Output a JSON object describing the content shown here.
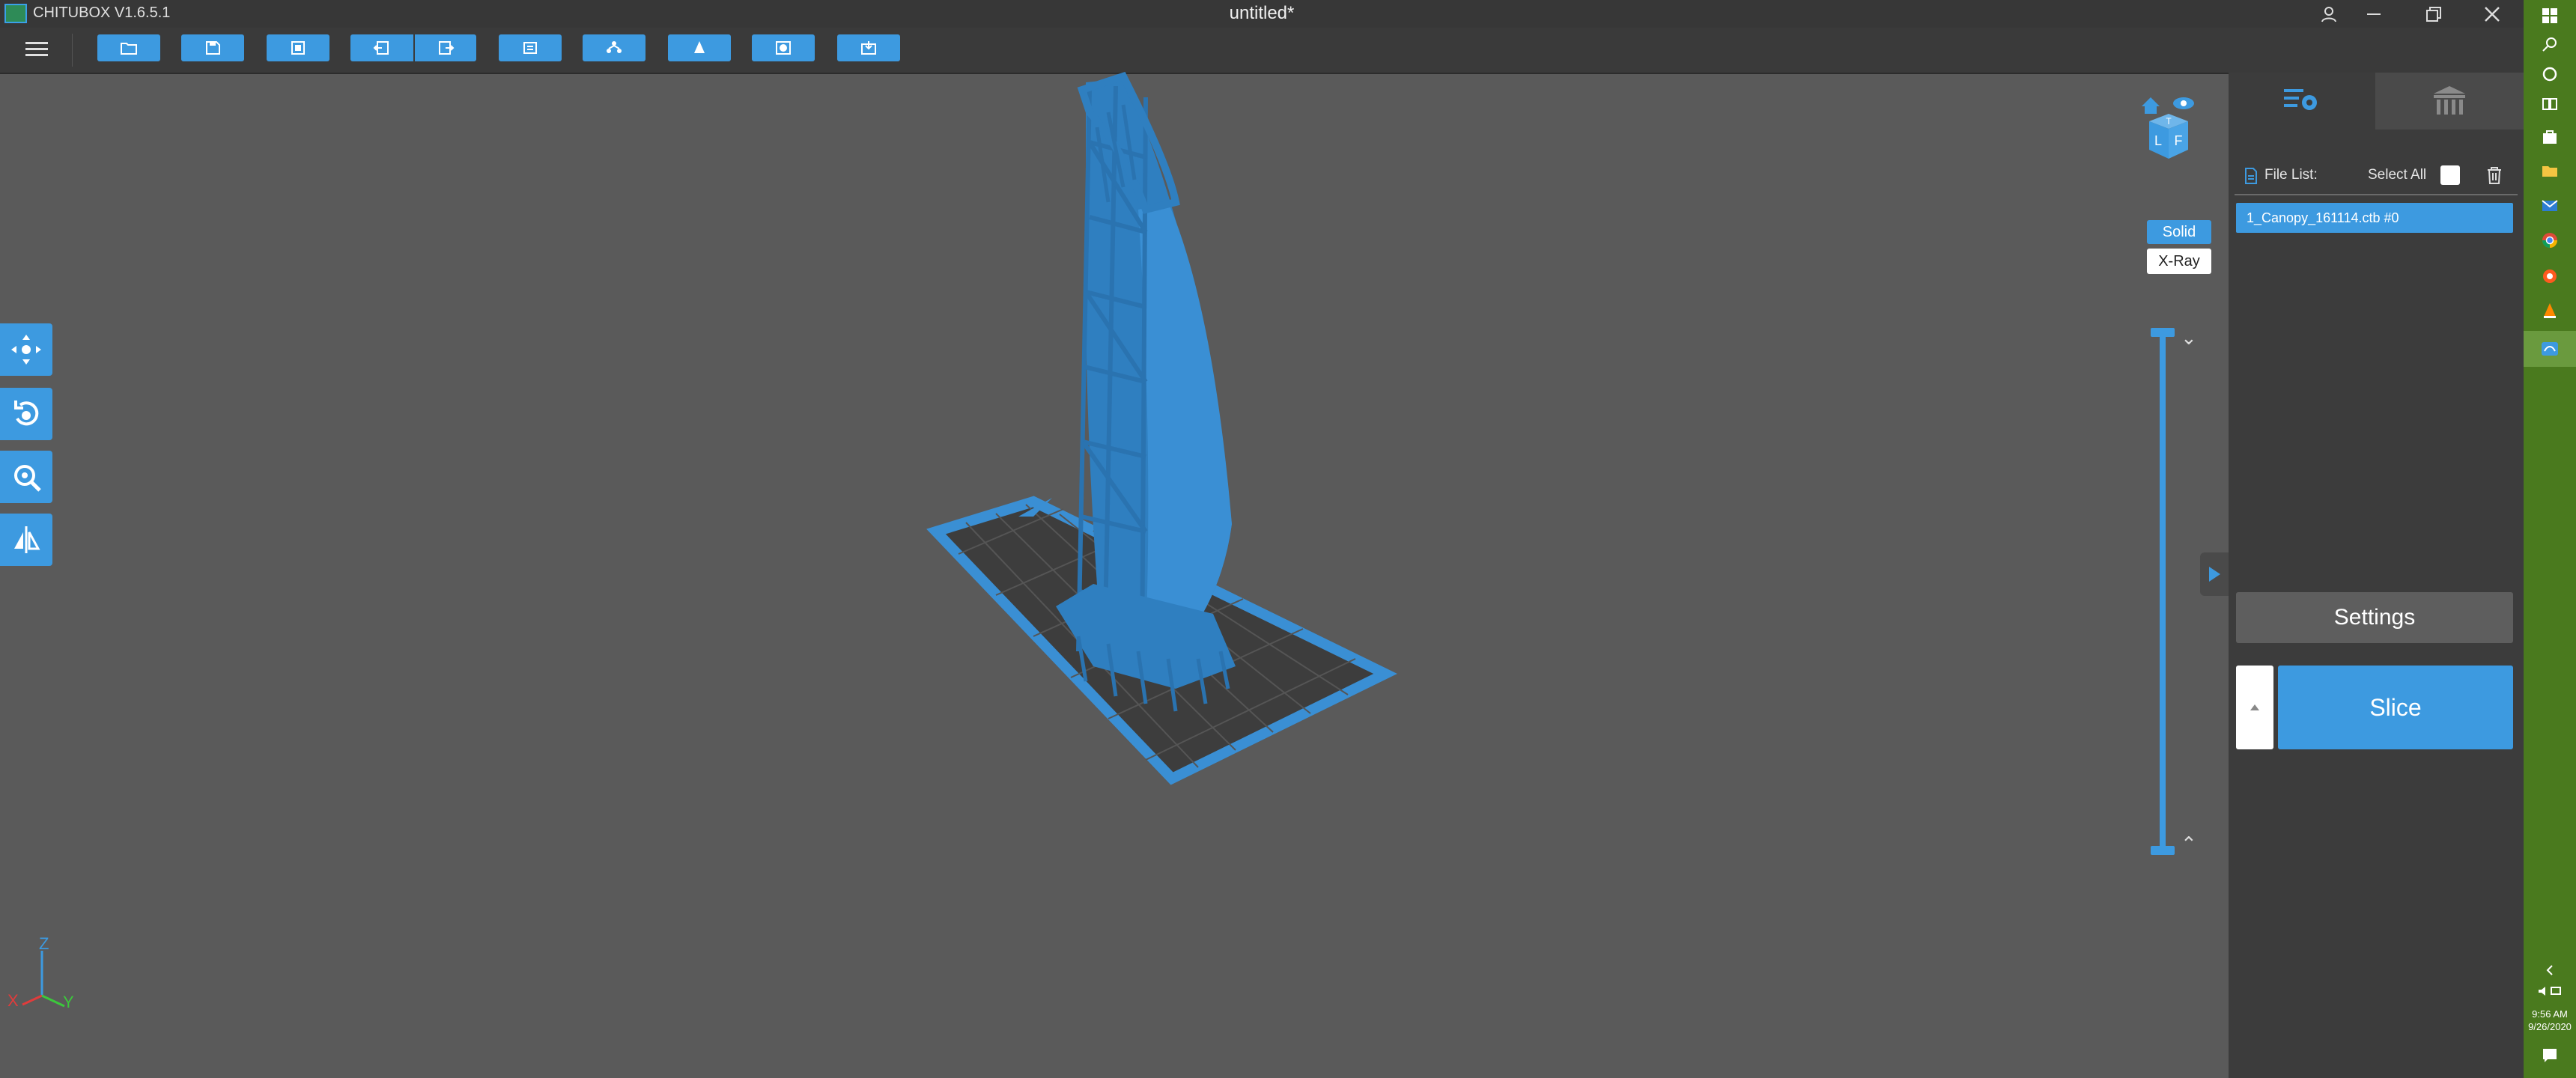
{
  "app": {
    "title": "CHITUBOX V1.6.5.1",
    "document_title": "untitled*"
  },
  "toolbar": {
    "items": [
      "open-file",
      "save",
      "fit-screen",
      "undo",
      "redo",
      "copy",
      "support",
      "hollow",
      "dig-hole",
      "batch-export"
    ]
  },
  "left_tools": [
    "move",
    "rotate",
    "scale",
    "mirror"
  ],
  "view": {
    "render_modes": {
      "solid": "Solid",
      "xray": "X-Ray"
    },
    "active_mode": "Solid",
    "cube_faces": {
      "top": "T",
      "left": "L",
      "front": "F"
    }
  },
  "axis": {
    "x": "X",
    "y": "Y",
    "z": "Z"
  },
  "panel": {
    "file_list_label": "File List:",
    "select_all_label": "Select All",
    "files": [
      "1_Canopy_161114.ctb #0"
    ],
    "settings_label": "Settings",
    "slice_label": "Slice"
  },
  "taskbar": {
    "time": "9:56 AM",
    "date": "9/26/2020"
  },
  "colors": {
    "accent": "#3d9ae0",
    "viewport": "#5a5a5a",
    "panel": "#3c3c3c",
    "taskbar": "#4a7a1e"
  }
}
